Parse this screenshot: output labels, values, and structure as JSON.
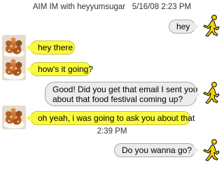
{
  "header": {
    "title": "AIM IM with heyyumsugar",
    "datetime": "5/16/08 2:23 PM"
  },
  "colors": {
    "incoming_bubble": "#fafa3c",
    "outgoing_bubble": "#ececec",
    "aim_runner": "#f5d500"
  },
  "messages": [
    {
      "direction": "outgoing",
      "lines": [
        "hey"
      ],
      "avatar_icon": "aim-running-man-icon"
    },
    {
      "direction": "incoming",
      "lines": [
        "hey there"
      ],
      "avatar_icon": "food-photo-avatar"
    },
    {
      "direction": "incoming",
      "lines": [
        "how's it going?"
      ],
      "avatar_icon": "food-photo-avatar"
    },
    {
      "direction": "outgoing",
      "lines": [
        "Good! Did you get that email I sent you",
        "about that food festival coming up?"
      ],
      "avatar_icon": "aim-running-man-icon"
    },
    {
      "direction": "incoming",
      "lines": [
        "oh yeah, i was going to ask you about that"
      ],
      "avatar_icon": "food-photo-avatar"
    },
    {
      "direction": "outgoing",
      "lines": [
        "Do you wanna go?"
      ],
      "avatar_icon": "aim-running-man-icon"
    }
  ],
  "mid_timestamp": "2:39 PM"
}
